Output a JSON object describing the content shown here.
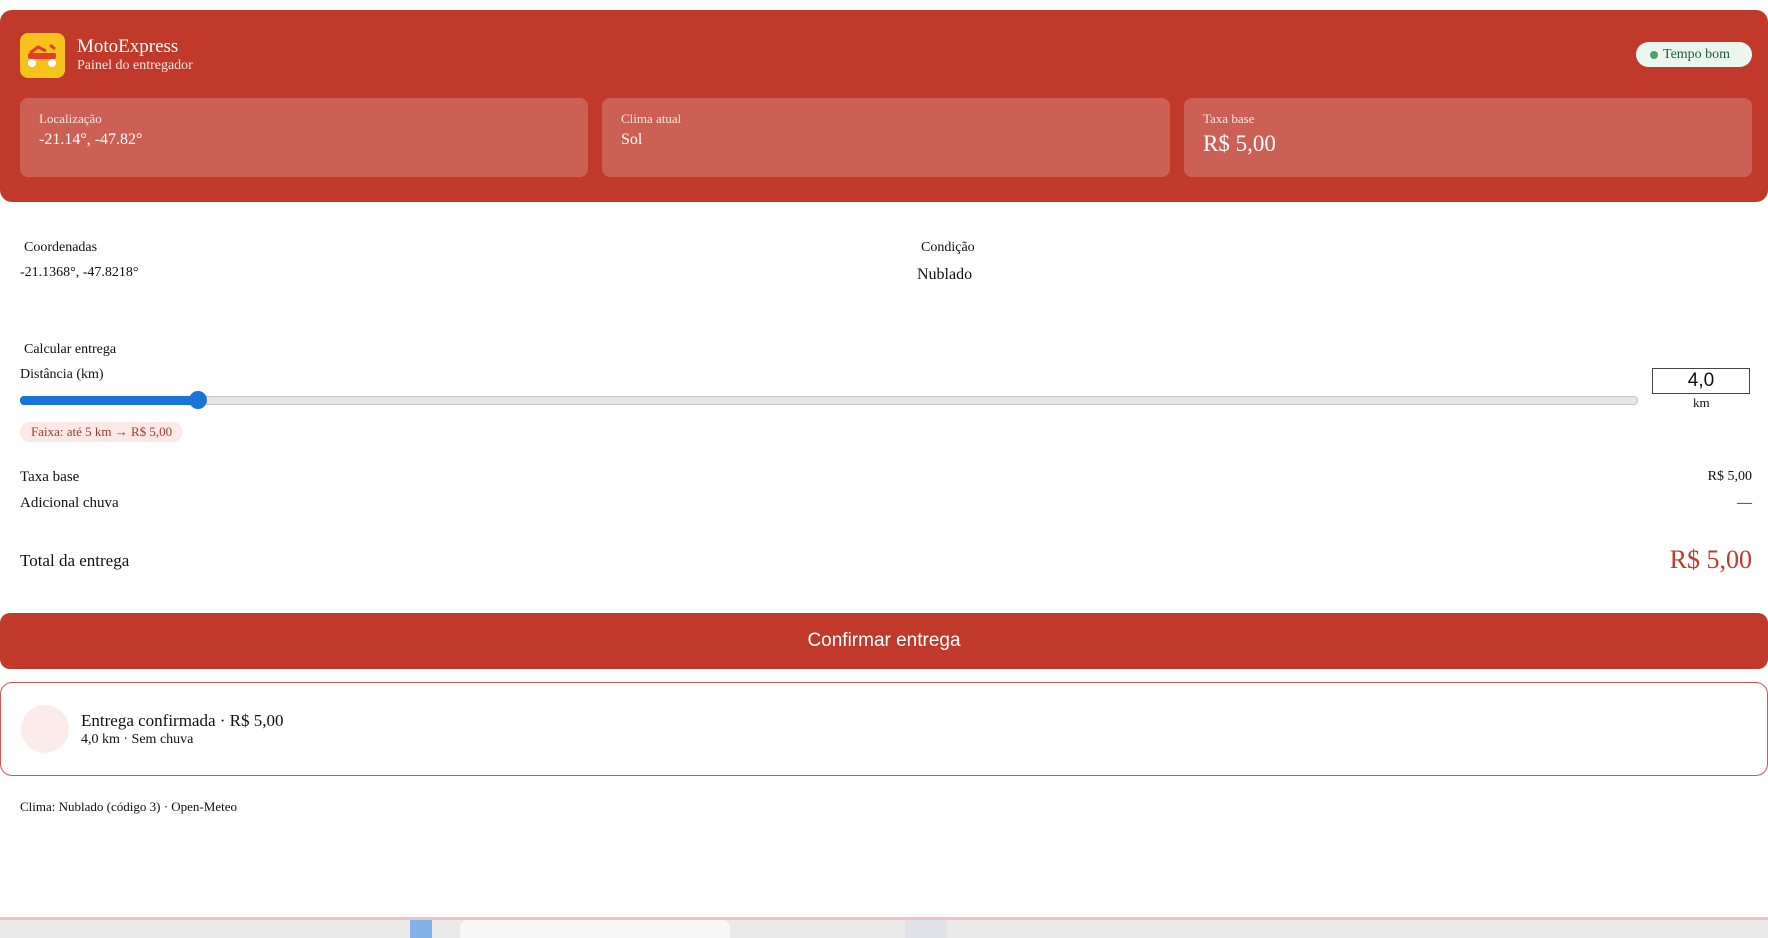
{
  "header": {
    "app_title": "MotoExpress",
    "app_subtitle": "Painel do entregador",
    "weather_badge": "Tempo bom",
    "cards": [
      {
        "label": "Localização",
        "value": "-21.14°, -47.82°"
      },
      {
        "label": "Clima atual",
        "value": "Sol"
      },
      {
        "label": "Taxa base",
        "value": "R$ 5,00"
      }
    ]
  },
  "info": {
    "coords_label": "Coordenadas",
    "coords_value": "-21.1368°, -47.8218°",
    "condition_label": "Condição",
    "condition_value": "Nublado"
  },
  "calculator": {
    "title": "Calcular entrega",
    "distance_label": "Distância (km)",
    "distance_value": "4,0",
    "distance_unit": "km",
    "slider_fraction": 0.11,
    "range_chip": "Faixa: até 5 km → R$ 5,00"
  },
  "summary": {
    "base_label": "Taxa base",
    "base_value": "R$ 5,00",
    "rain_label": "Adicional chuva",
    "rain_value": "—",
    "total_label": "Total da entrega",
    "total_value": "R$ 5,00"
  },
  "confirm_button": "Confirmar entrega",
  "confirmation": {
    "title": "Entrega confirmada · R$ 5,00",
    "subtitle": "4,0 km · Sem chuva"
  },
  "footer": "Clima: Nublado (código 3) · Open-Meteo",
  "colors": {
    "brand": "#c0392b",
    "icon_bg": "#f6c21c",
    "slider": "#1a73d9",
    "good_weather_dot": "#49a36d"
  },
  "icons": {
    "app": "scooter-icon",
    "weather_badge": "status-dot-icon"
  }
}
